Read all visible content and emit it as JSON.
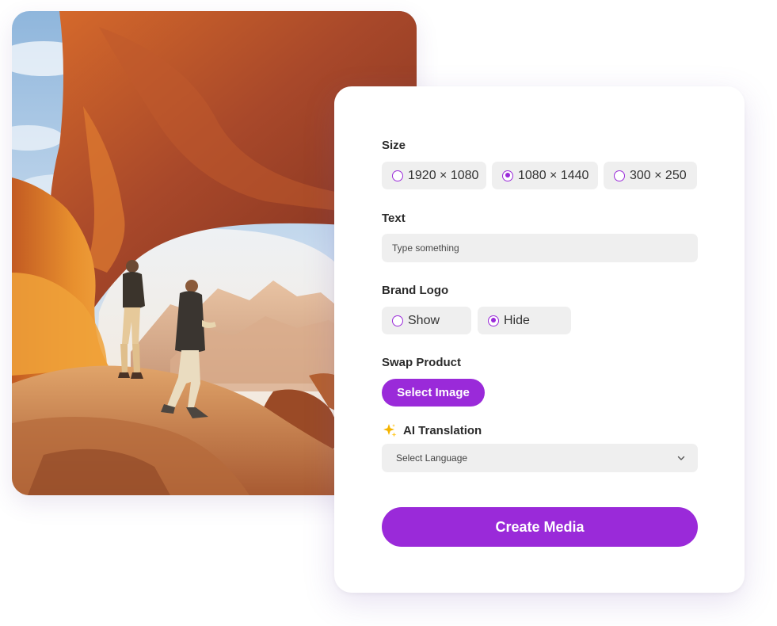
{
  "photo": {
    "alt": "Two hikers standing under a red rock arch in the desert"
  },
  "form": {
    "size": {
      "label": "Size",
      "options": [
        {
          "label": "1920 × 1080",
          "selected": false
        },
        {
          "label": "1080 × 1440",
          "selected": true
        },
        {
          "label": "300 × 250",
          "selected": false
        }
      ]
    },
    "text": {
      "label": "Text",
      "placeholder": "Type something",
      "value": ""
    },
    "brand_logo": {
      "label": "Brand Logo",
      "options": [
        {
          "label": "Show",
          "selected": false
        },
        {
          "label": "Hide",
          "selected": true
        }
      ]
    },
    "swap_product": {
      "label": "Swap Product",
      "button_label": "Select Image"
    },
    "ai_translation": {
      "label": "AI Translation",
      "icon": "sparkle-icon",
      "select_value": "Select Language"
    },
    "submit_label": "Create Media"
  },
  "colors": {
    "accent": "#9a2ad9",
    "field_bg": "#efefef",
    "text": "#2b2b2b",
    "sparkle": "#f5b400"
  }
}
